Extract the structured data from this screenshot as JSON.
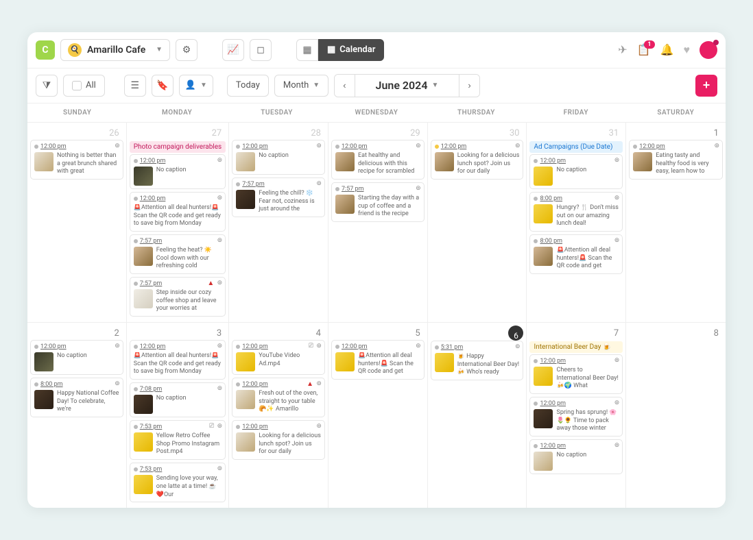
{
  "topbar": {
    "account_name": "Amarillo Cafe",
    "calendar_label": "Calendar",
    "notification_count": "1"
  },
  "toolbar": {
    "all_label": "All",
    "today_label": "Today",
    "range_label": "Month",
    "month_label": "June 2024"
  },
  "days": [
    "SUNDAY",
    "MONDAY",
    "TUESDAY",
    "WEDNESDAY",
    "THURSDAY",
    "FRIDAY",
    "SATURDAY"
  ],
  "banners": {
    "photo": "Photo campaign deliverables",
    "ads": "Ad Campaigns (Due Date)",
    "beer": "International Beer Day 🍺"
  },
  "cells": [
    {
      "num": "26",
      "mute": true,
      "cards": [
        {
          "time": "12:00 pm",
          "cap": "Nothing is better than a great brunch shared with great",
          "th": "lt"
        }
      ]
    },
    {
      "num": "27",
      "mute": true,
      "banner": "photo",
      "cards": [
        {
          "time": "12:00 pm",
          "cap": "No caption",
          "th": "gr"
        },
        {
          "time": "12:00 pm",
          "cap": "🚨Attention all deal hunters!🚨 Scan the QR code and get ready to save big from Monday",
          "nothumb": true
        },
        {
          "time": "7:57 pm",
          "cap": "Feeling the heat? ☀️ Cool down with our refreshing cold",
          "th": ""
        },
        {
          "time": "7:57 pm",
          "cap": "Step inside our cozy coffee shop and leave your worries at",
          "th": "wh",
          "warn": true
        }
      ]
    },
    {
      "num": "28",
      "mute": true,
      "cards": [
        {
          "time": "12:00 pm",
          "cap": "No caption",
          "th": "lt"
        },
        {
          "time": "7:57 pm",
          "cap": "Feeling the chill? ❄️ Fear not, coziness is just around the",
          "th": "dk"
        }
      ]
    },
    {
      "num": "29",
      "mute": true,
      "cards": [
        {
          "time": "12:00 pm",
          "cap": "Eat healthy and delicious with this recipe for scrambled",
          "th": ""
        },
        {
          "time": "7:57 pm",
          "cap": "Starting the day with a cup of coffee and a friend is the recipe",
          "th": ""
        }
      ]
    },
    {
      "num": "30",
      "mute": true,
      "cards": [
        {
          "time": "12:00 pm",
          "cap": "Looking for a delicious lunch spot? Join us for our daily",
          "th": "",
          "doty": true
        }
      ]
    },
    {
      "num": "31",
      "mute": true,
      "banner": "ads",
      "cards": [
        {
          "time": "12:00 pm",
          "cap": "No caption",
          "th": "yl"
        },
        {
          "time": "8:00 pm",
          "cap": "Hungry? 🍴 Don't miss out on our amazing lunch deal!",
          "th": "yl"
        },
        {
          "time": "8:00 pm",
          "cap": "🚨Attention all deal hunters!🚨 Scan the QR code and get",
          "th": ""
        }
      ]
    },
    {
      "num": "1",
      "cards": [
        {
          "time": "12:00 pm",
          "cap": "Eating tasty and healthy food is very easy, learn how to",
          "th": ""
        }
      ]
    },
    {
      "num": "2",
      "cards": [
        {
          "time": "12:00 pm",
          "cap": "No caption",
          "th": "gr"
        },
        {
          "time": "8:00 pm",
          "cap": "Happy National Coffee Day! To celebrate, we're",
          "th": "dk"
        }
      ]
    },
    {
      "num": "3",
      "cards": [
        {
          "time": "12:00 pm",
          "cap": "🚨Attention all deal hunters!🚨 Scan the QR code and get ready to save big from Monday",
          "nothumb": true
        },
        {
          "time": "7:08 pm",
          "cap": "No caption",
          "th": "dk"
        },
        {
          "time": "7:53 pm",
          "cap": "Yellow Retro Coffee Shop Promo Instagram Post.mp4",
          "th": "yl",
          "vid": true
        },
        {
          "time": "7:53 pm",
          "cap": "Sending love your way, one latte at a time! ☕❤️Our",
          "th": "yl"
        }
      ]
    },
    {
      "num": "4",
      "cards": [
        {
          "time": "12:00 pm",
          "cap": "YouTube Video Ad.mp4",
          "th": "yl",
          "vid": true
        },
        {
          "time": "12:00 pm",
          "cap": "Fresh out of the oven, straight to your table 🥐✨ Amarillo",
          "th": "lt",
          "warn": true
        },
        {
          "time": "12:00 pm",
          "cap": "Looking for a delicious lunch spot? Join us for our daily",
          "th": "lt"
        }
      ]
    },
    {
      "num": "5",
      "cards": [
        {
          "time": "12:00 pm",
          "cap": "🚨Attention all deal hunters!🚨 Scan the QR code and get",
          "th": "yl"
        }
      ]
    },
    {
      "num": "6",
      "today": true,
      "cards": [
        {
          "time": "5:31 pm",
          "cap": "🍺 Happy International Beer Day! 🍻 Who's ready",
          "th": "yl"
        }
      ]
    },
    {
      "num": "7",
      "banner": "beer",
      "cards": [
        {
          "time": "12:00 pm",
          "cap": "Cheers to International Beer Day! 🍻🌍 What",
          "th": "yl"
        },
        {
          "time": "12:00 pm",
          "cap": "Spring has sprung! 🌸🌷🌻 Time to pack away those winter",
          "th": "dk"
        },
        {
          "time": "12:00 pm",
          "cap": "No caption",
          "th": "lt"
        }
      ]
    },
    {
      "num": "8",
      "cards": []
    }
  ]
}
